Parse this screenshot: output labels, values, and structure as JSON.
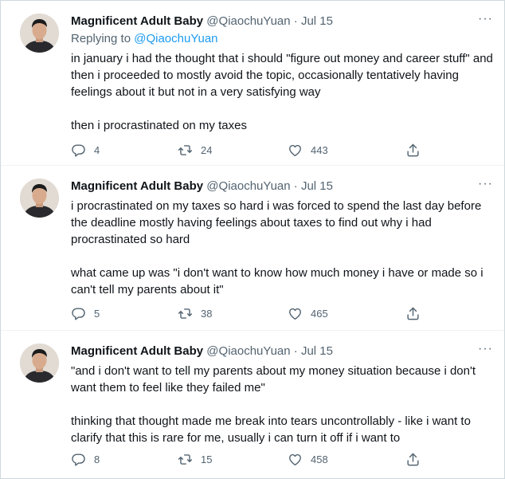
{
  "tweets": [
    {
      "author": "Magnificent Adult Baby",
      "handle": "@QiaochuYuan",
      "separator": "·",
      "date": "Jul 15",
      "replying_to_label": "Replying to",
      "replying_to_handle": "@QiaochuYuan",
      "paragraphs": [
        "in january i had the thought that i should \"figure out money and career stuff\" and then i proceeded to mostly avoid the topic, occasionally tentatively having feelings about it but not in a very satisfying way",
        "then i procrastinated on my taxes"
      ],
      "replies": "4",
      "retweets": "24",
      "likes": "443"
    },
    {
      "author": "Magnificent Adult Baby",
      "handle": "@QiaochuYuan",
      "separator": "·",
      "date": "Jul 15",
      "paragraphs": [
        "i procrastinated on my taxes so hard i was forced to spend the last day before the deadline mostly having feelings about taxes to find out why i had procrastinated so hard",
        "what came up was \"i don't want to know how much money i have or made so i can't tell my parents about it\""
      ],
      "replies": "5",
      "retweets": "38",
      "likes": "465"
    },
    {
      "author": "Magnificent Adult Baby",
      "handle": "@QiaochuYuan",
      "separator": "·",
      "date": "Jul 15",
      "paragraphs": [
        "\"and i don't want to tell my parents about my money situation because i don't want them to feel like they failed me\"",
        "thinking that thought made me break into tears uncontrollably - like i want to clarify that this is rare for me, usually i can turn it off if i want to"
      ],
      "replies": "8",
      "retweets": "15",
      "likes": "458"
    }
  ],
  "icons": {
    "more": "more-horizontal-icon",
    "reply": "reply-icon",
    "retweet": "retweet-icon",
    "like": "heart-icon",
    "share": "share-icon"
  },
  "colors": {
    "text": "#0f1419",
    "secondary": "#536471",
    "link": "#1d9bf0",
    "border": "#eff3f4"
  },
  "more_glyph": "···"
}
